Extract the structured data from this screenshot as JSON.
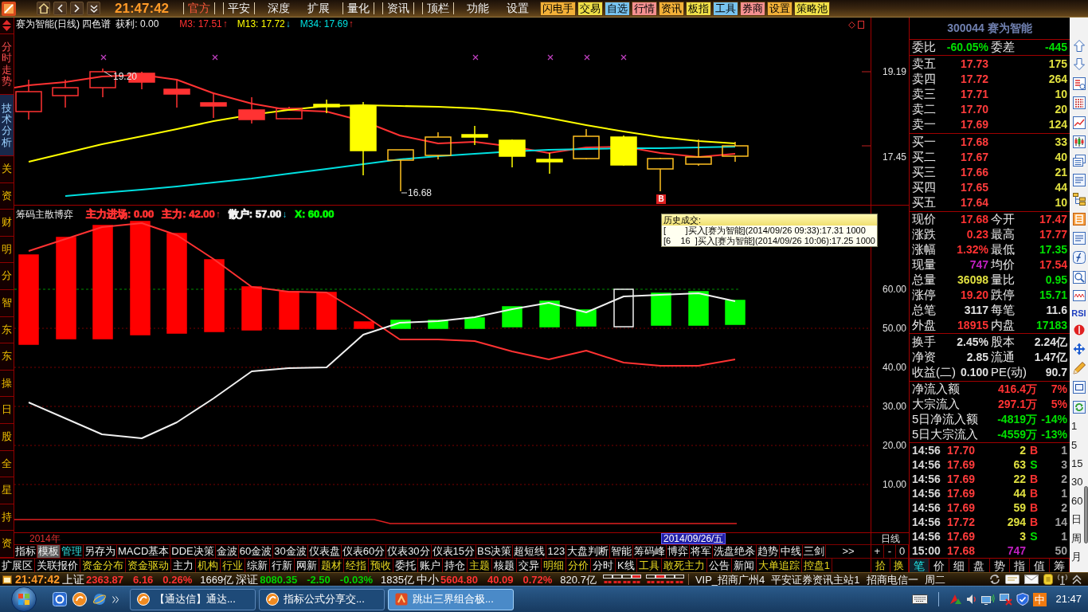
{
  "top_bar": {
    "clock": "21:47:42",
    "menu": [
      {
        "label": "官方",
        "selected": true,
        "divided": true
      },
      {
        "label": "平安",
        "selected": false,
        "divided": true
      },
      {
        "label": "深度",
        "selected": false,
        "divided": false
      },
      {
        "label": "扩展",
        "selected": false,
        "divided": false
      },
      {
        "label": "量化",
        "selected": false,
        "divided": true
      },
      {
        "label": "资讯",
        "selected": false,
        "divided": true
      },
      {
        "label": "顶栏",
        "selected": false,
        "divided": true
      },
      {
        "label": "功能",
        "selected": false,
        "divided": false
      },
      {
        "label": "设置",
        "selected": false,
        "divided": false
      }
    ],
    "quick_buttons": [
      {
        "label": "闪电手",
        "color": "#f2b038"
      },
      {
        "label": "交易",
        "color": "#f0e048"
      },
      {
        "label": "自选",
        "color": "#78c4f0"
      },
      {
        "label": "行情",
        "color": "#f49090"
      },
      {
        "label": "资讯",
        "color": "#f2b038"
      },
      {
        "label": "板指",
        "color": "#f0e048"
      },
      {
        "label": "工具",
        "color": "#78c4f0"
      },
      {
        "label": "券商",
        "color": "#f49090"
      },
      {
        "label": "设置",
        "color": "#f2b038"
      },
      {
        "label": "策略池",
        "color": "#f0e048"
      }
    ]
  },
  "side_tabs": [
    {
      "label": "分时走势",
      "kind": "view",
      "selected": false
    },
    {
      "label": "技术分析",
      "kind": "view",
      "selected": true
    },
    {
      "label": "关",
      "kind": "info",
      "selected": false
    },
    {
      "label": "资",
      "kind": "info",
      "selected": false
    },
    {
      "label": "财",
      "kind": "info",
      "selected": false
    },
    {
      "label": "明",
      "kind": "info",
      "selected": false
    },
    {
      "label": "分",
      "kind": "info",
      "selected": false
    },
    {
      "label": "智",
      "kind": "info",
      "selected": false
    },
    {
      "label": "东",
      "kind": "info",
      "selected": false
    },
    {
      "label": "东",
      "kind": "info",
      "selected": false
    },
    {
      "label": "操",
      "kind": "info",
      "selected": false
    },
    {
      "label": "日",
      "kind": "info",
      "selected": false
    },
    {
      "label": "股",
      "kind": "info",
      "selected": false
    },
    {
      "label": "全",
      "kind": "info",
      "selected": false
    },
    {
      "label": "星",
      "kind": "info",
      "selected": false
    },
    {
      "label": "持",
      "kind": "info",
      "selected": false
    },
    {
      "label": "资",
      "kind": "info",
      "selected": false
    }
  ],
  "price_chart": {
    "title": "赛为智能(日线) 四色谱",
    "profit": "获利: 0.00",
    "averages": [
      {
        "label": "M3: 17.51",
        "arrow": "↑",
        "rising": true,
        "color": "#ff3232"
      },
      {
        "label": "M13: 17.72",
        "arrow": "↓",
        "rising": false,
        "color": "#ffff00"
      },
      {
        "label": "M34: 17.69",
        "arrow": "↑",
        "rising": true,
        "color": "#00e0e0"
      }
    ],
    "high_label": "19.20",
    "low_label": "16.68",
    "signal": "B",
    "axis_labels": [
      "19.19",
      "17.45"
    ]
  },
  "indicator_chart": {
    "title": "筹码主散博弈",
    "readings": [
      {
        "label": "主力进场: 0.00",
        "color": "#ff3232"
      },
      {
        "label": "主力: 42.00",
        "arrow": "↑",
        "rising": true,
        "color": "#ff3232"
      },
      {
        "label": "散户: 57.00",
        "arrow": "↓",
        "rising": false,
        "color": "#f0f0f0"
      },
      {
        "label": "X: 60.00",
        "color": "#00ff00"
      }
    ],
    "axis_labels": [
      "60.00",
      "50.00",
      "40.00",
      "30.00",
      "20.00",
      "10.00"
    ]
  },
  "trade_tooltip": {
    "title": "历史成交:",
    "lines": [
      "[        ]买入[赛为智能](2014/09/26 09:33):17.31 1000",
      "[6    16  ]买入[赛为智能](2014/09/26 10:06):17.25 1000"
    ]
  },
  "date_bar": {
    "year": "2014年",
    "cursor_date": "2014/09/26/五",
    "period": "日线"
  },
  "template_tabs": [
    {
      "label": "指标",
      "selected": false,
      "highlighted": false
    },
    {
      "label": "模板",
      "selected": true,
      "highlighted": false
    },
    {
      "label": "管理",
      "selected": false,
      "highlighted": true
    },
    {
      "label": "另存为",
      "selected": false,
      "highlighted": false
    },
    {
      "label": "MACD基本",
      "selected": false,
      "highlighted": false
    },
    {
      "label": "DDE决策",
      "selected": false,
      "highlighted": false
    },
    {
      "label": "金波",
      "selected": false,
      "highlighted": false
    },
    {
      "label": "60金波",
      "selected": false,
      "highlighted": false
    },
    {
      "label": "30金波",
      "selected": false,
      "highlighted": false
    },
    {
      "label": "仪表盘",
      "selected": false,
      "highlighted": false
    },
    {
      "label": "仪表60分",
      "selected": false,
      "highlighted": false
    },
    {
      "label": "仪表30分",
      "selected": false,
      "highlighted": false
    },
    {
      "label": "仪表15分",
      "selected": false,
      "highlighted": false
    },
    {
      "label": "BS决策",
      "selected": false,
      "highlighted": false
    },
    {
      "label": "超短线",
      "selected": false,
      "highlighted": false
    },
    {
      "label": "123",
      "selected": false,
      "highlighted": false
    },
    {
      "label": "大盘判断",
      "selected": false,
      "highlighted": false
    },
    {
      "label": "智能",
      "selected": false,
      "highlighted": false
    },
    {
      "label": "筹码峰",
      "selected": false,
      "highlighted": false
    },
    {
      "label": "博弈",
      "selected": false,
      "highlighted": false
    },
    {
      "label": "将军",
      "selected": false,
      "highlighted": false
    },
    {
      "label": "洗盘绝杀",
      "selected": false,
      "highlighted": false
    },
    {
      "label": "趋势",
      "selected": false,
      "highlighted": false
    },
    {
      "label": "中线",
      "selected": false,
      "highlighted": false
    },
    {
      "label": "三剑",
      "selected": false,
      "highlighted": false
    }
  ],
  "template_more": ">>",
  "zoom_buttons": [
    "+",
    "-",
    "0"
  ],
  "extension_tabs": [
    {
      "label": "扩展区",
      "highlighted": false
    },
    {
      "label": "关联报价",
      "highlighted": false
    },
    {
      "label": "资金分布",
      "highlighted": true
    },
    {
      "label": "资金驱动",
      "highlighted": true
    },
    {
      "label": "主力",
      "highlighted": false
    },
    {
      "label": "机构",
      "highlighted": true
    },
    {
      "label": "行业",
      "highlighted": true
    },
    {
      "label": "综新",
      "highlighted": false
    },
    {
      "label": "行新",
      "highlighted": false
    },
    {
      "label": "网新",
      "highlighted": false
    },
    {
      "label": "题材",
      "highlighted": true
    },
    {
      "label": "经指",
      "highlighted": true
    },
    {
      "label": "预收",
      "highlighted": true
    },
    {
      "label": "委托",
      "highlighted": false
    },
    {
      "label": "账户",
      "highlighted": false
    },
    {
      "label": "持仓",
      "highlighted": false
    },
    {
      "label": "主题",
      "highlighted": true
    },
    {
      "label": "核题",
      "highlighted": false
    },
    {
      "label": "交异",
      "highlighted": false
    },
    {
      "label": "明细",
      "highlighted": true
    },
    {
      "label": "分价",
      "highlighted": true
    },
    {
      "label": "分时",
      "highlighted": false
    },
    {
      "label": "K线",
      "highlighted": false
    },
    {
      "label": "工具",
      "highlighted": true
    },
    {
      "label": "敢死主力",
      "highlighted": true
    },
    {
      "label": "公告",
      "highlighted": false
    },
    {
      "label": "新闻",
      "highlighted": false
    },
    {
      "label": "大单追踪",
      "highlighted": true
    },
    {
      "label": "控盘1",
      "highlighted": true
    }
  ],
  "extension_buttons": [
    "拾",
    "换"
  ],
  "quote_panel": {
    "stock": "300044 赛为智能",
    "commission": [
      {
        "label": "委比",
        "value": "-60.05%",
        "color": "#00e000"
      },
      {
        "label": "委差",
        "value": "-445",
        "color": "#00e000"
      }
    ],
    "asks": [
      {
        "label": "卖五",
        "price": "17.73",
        "volume": "175"
      },
      {
        "label": "卖四",
        "price": "17.72",
        "volume": "264"
      },
      {
        "label": "卖三",
        "price": "17.71",
        "volume": "10"
      },
      {
        "label": "卖二",
        "price": "17.70",
        "volume": "20"
      },
      {
        "label": "卖一",
        "price": "17.69",
        "volume": "124"
      }
    ],
    "bids": [
      {
        "label": "买一",
        "price": "17.68",
        "volume": "33"
      },
      {
        "label": "买二",
        "price": "17.67",
        "volume": "40"
      },
      {
        "label": "买三",
        "price": "17.66",
        "volume": "21"
      },
      {
        "label": "买四",
        "price": "17.65",
        "volume": "44"
      },
      {
        "label": "买五",
        "price": "17.64",
        "volume": "10"
      }
    ],
    "stats": [
      [
        {
          "label": "现价",
          "value": "17.68",
          "color": "#ff3232"
        },
        {
          "label": "今开",
          "value": "17.47",
          "color": "#ff3232"
        }
      ],
      [
        {
          "label": "涨跌",
          "value": "0.23",
          "color": "#ff3232"
        },
        {
          "label": "最高",
          "value": "17.77",
          "color": "#ff3232"
        }
      ],
      [
        {
          "label": "涨幅",
          "value": "1.32%",
          "color": "#ff3232"
        },
        {
          "label": "最低",
          "value": "17.35",
          "color": "#00e000"
        }
      ],
      [
        {
          "label": "现量",
          "value": "747",
          "color": "#c020c0"
        },
        {
          "label": "均价",
          "value": "17.54",
          "color": "#ff3232"
        }
      ],
      [
        {
          "label": "总量",
          "value": "36098",
          "color": "#e0e040"
        },
        {
          "label": "量比",
          "value": "0.95",
          "color": "#00e000"
        }
      ],
      [
        {
          "label": "涨停",
          "value": "19.20",
          "color": "#ff3232"
        },
        {
          "label": "跌停",
          "value": "15.71",
          "color": "#00e000"
        }
      ],
      [
        {
          "label": "总笔",
          "value": "3117",
          "color": "#e0e0e0"
        },
        {
          "label": "每笔",
          "value": "11.6",
          "color": "#e0e0e0"
        }
      ],
      [
        {
          "label": "外盘",
          "value": "18915",
          "color": "#ff3232"
        },
        {
          "label": "内盘",
          "value": "17183",
          "color": "#00e000"
        }
      ]
    ],
    "fundamentals": [
      [
        {
          "label": "换手",
          "value": "2.45%",
          "color": "#e0e0e0"
        },
        {
          "label": "股本",
          "value": "2.24亿",
          "color": "#e0e0e0"
        }
      ],
      [
        {
          "label": "净资",
          "value": "2.85",
          "color": "#e0e0e0"
        },
        {
          "label": "流通",
          "value": "1.47亿",
          "color": "#e0e0e0"
        }
      ],
      [
        {
          "label": "收益(二)",
          "value": "0.100",
          "color": "#e0e0e0"
        },
        {
          "label": "PE(动)",
          "value": "90.7",
          "color": "#e0e0e0"
        }
      ]
    ],
    "flows": [
      {
        "label": "净流入额",
        "amount": "416.4万",
        "percent": "7%",
        "color": "#ff3232"
      },
      {
        "label": "大宗流入",
        "amount": "297.1万",
        "percent": "5%",
        "color": "#ff3232"
      },
      {
        "label": "5日净流入额",
        "amount": "-4819万",
        "percent": "-14%",
        "color": "#00e000"
      },
      {
        "label": "5日大宗流入",
        "amount": "-4559万",
        "percent": "-13%",
        "color": "#00e000"
      }
    ],
    "ticks": [
      {
        "kind": "trade",
        "time": "14:56",
        "price": "17.70",
        "volume": "2",
        "side": "B",
        "count": "1",
        "color": "#ff3232"
      },
      {
        "kind": "trade",
        "time": "14:56",
        "price": "17.69",
        "volume": "63",
        "side": "S",
        "count": "3",
        "color": "#00e000"
      },
      {
        "kind": "trade",
        "time": "14:56",
        "price": "17.69",
        "volume": "22",
        "side": "B",
        "count": "2",
        "color": "#ff3232"
      },
      {
        "kind": "trade",
        "time": "14:56",
        "price": "17.69",
        "volume": "44",
        "side": "B",
        "count": "1",
        "color": "#ff3232"
      },
      {
        "kind": "trade",
        "time": "14:56",
        "price": "17.69",
        "volume": "59",
        "side": "B",
        "count": "2",
        "color": "#ff3232"
      },
      {
        "kind": "trade",
        "time": "14:56",
        "price": "17.72",
        "volume": "294",
        "side": "B",
        "count": "14",
        "color": "#ff3232"
      },
      {
        "kind": "trade",
        "time": "14:56",
        "price": "17.69",
        "volume": "3",
        "side": "S",
        "count": "1",
        "color": "#00e000"
      },
      {
        "kind": "summary",
        "time": "15:00",
        "price": "17.68",
        "volume": "747",
        "count": "50"
      }
    ],
    "tabs": [
      {
        "label": "笔",
        "selected": true
      },
      {
        "label": "价",
        "selected": false
      },
      {
        "label": "细",
        "selected": false
      },
      {
        "label": "盘",
        "selected": false
      },
      {
        "label": "势",
        "selected": false
      },
      {
        "label": "指",
        "selected": false
      },
      {
        "label": "值",
        "selected": false
      },
      {
        "label": "筹",
        "selected": false
      }
    ]
  },
  "side_toolbar": {
    "label": "RSI",
    "periods": [
      "1",
      "5",
      "15",
      "30",
      "60",
      "日",
      "周",
      "月"
    ]
  },
  "status_bar": {
    "clock": "21:47:42",
    "indices": [
      {
        "name": "上证",
        "value": "2363.87",
        "change": "6.16",
        "percent": "0.26%",
        "turnover": "1669亿",
        "rising": true
      },
      {
        "name": "深证",
        "value": "8080.35",
        "change": "-2.50",
        "percent": "-0.03%",
        "turnover": "1835亿",
        "rising": false
      },
      {
        "name": "中小",
        "value": "5604.80",
        "change": "40.09",
        "percent": "0.72%",
        "turnover": "820.7亿",
        "rising": true
      }
    ],
    "info": [
      "VIP_招商广州4",
      "平安证券资讯主站1",
      "招商电信一",
      "周二"
    ]
  },
  "taskbar": {
    "tasks": [
      {
        "label": "【通达信】通达...",
        "selected": false
      },
      {
        "label": "指标公式分享交...",
        "selected": false
      },
      {
        "label": "跳出三界组合极...",
        "selected": true
      }
    ],
    "ime": "中",
    "clock": "21:47"
  }
}
